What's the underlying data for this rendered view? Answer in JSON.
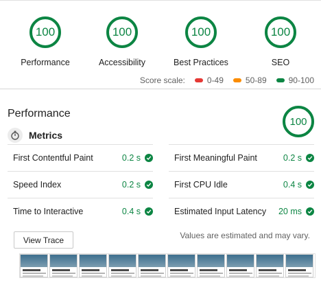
{
  "categories": [
    {
      "score": "100",
      "label": "Performance"
    },
    {
      "score": "100",
      "label": "Accessibility"
    },
    {
      "score": "100",
      "label": "Best Practices"
    },
    {
      "score": "100",
      "label": "SEO"
    }
  ],
  "score_scale": {
    "label": "Score scale:",
    "ranges": [
      {
        "text": "0-49",
        "color": "#e53935"
      },
      {
        "text": "50-89",
        "color": "#fb8c00"
      },
      {
        "text": "90-100",
        "color": "#0c8543"
      }
    ]
  },
  "performance": {
    "title": "Performance",
    "score": "100",
    "metrics_title": "Metrics",
    "metrics_icon": "stopwatch-icon",
    "metrics": [
      {
        "name": "First Contentful Paint",
        "value": "0.2 s"
      },
      {
        "name": "First Meaningful Paint",
        "value": "0.2 s"
      },
      {
        "name": "Speed Index",
        "value": "0.2 s"
      },
      {
        "name": "First CPU Idle",
        "value": "0.4 s"
      },
      {
        "name": "Time to Interactive",
        "value": "0.4 s"
      },
      {
        "name": "Estimated Input Latency",
        "value": "20 ms"
      }
    ],
    "view_trace_label": "View Trace",
    "estimate_note": "Values are estimated and may vary."
  },
  "colors": {
    "pass": "#0c8543"
  }
}
